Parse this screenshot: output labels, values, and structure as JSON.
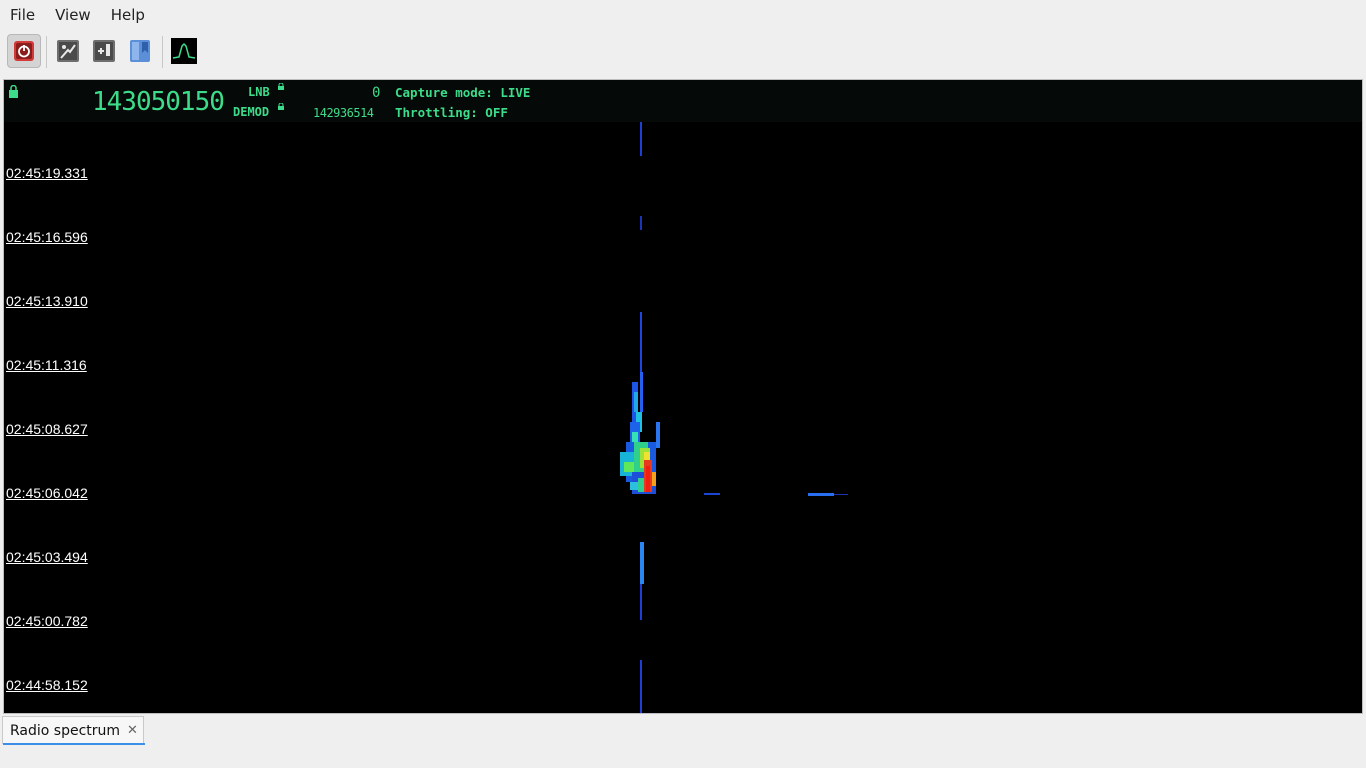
{
  "menu": [
    "File",
    "View",
    "Help"
  ],
  "toolbar": {
    "buttons": [
      {
        "name": "power-button",
        "icon": "power-icon"
      },
      {
        "name": "settings-button",
        "icon": "settings-icon"
      },
      {
        "name": "add-panel-button",
        "icon": "add-panel-icon"
      },
      {
        "name": "bookmark-button",
        "icon": "bookmark-icon"
      },
      {
        "name": "spectrum-button",
        "icon": "spectrum-icon"
      }
    ]
  },
  "info": {
    "main_freq": "143050150",
    "lnb_label": "LNB",
    "lnb_value": "0",
    "demod_label": "DEMOD",
    "demod_value": "142936514",
    "capture_mode": "Capture mode: LIVE",
    "throttling": "Throttling: OFF"
  },
  "timestamps": [
    "02:45:19.331",
    "02:45:16.596",
    "02:45:13.910",
    "02:45:11.316",
    "02:45:08.627",
    "02:45:06.042",
    "02:45:03.494",
    "02:45:00.782",
    "02:44:58.152"
  ],
  "tab": {
    "label": "Radio spectrum",
    "close": "✕"
  },
  "colors": {
    "display_green": "#3ddc8a",
    "tab_accent": "#3d8ee8"
  }
}
